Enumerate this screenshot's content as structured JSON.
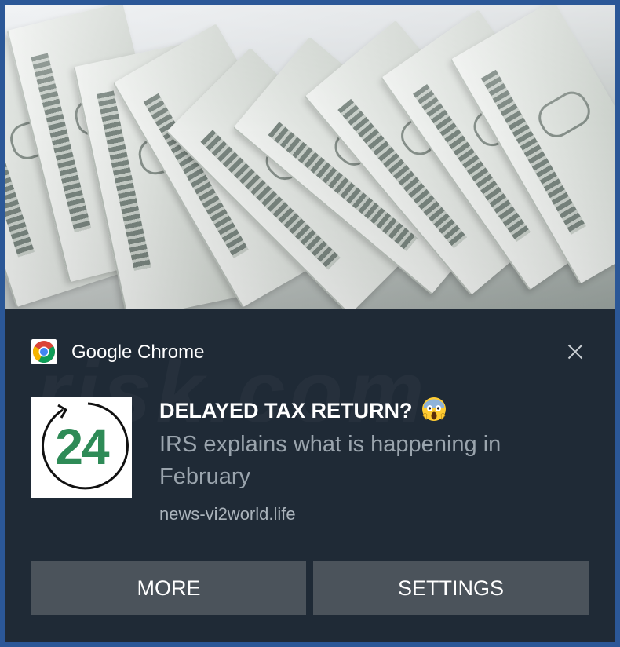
{
  "notification": {
    "app_name": "Google Chrome",
    "app_icon": "chrome-icon",
    "close_icon": "close-icon",
    "logo": {
      "text": "24",
      "icon": "circular-arrow-24-icon",
      "color": "#2e8b57"
    },
    "title": "DELAYED TAX RETURN?",
    "title_emoji": "face-screaming-in-fear-emoji",
    "body": "IRS explains what is happening in February",
    "domain": "news-vi2world.life",
    "hero_image": "hundred-dollar-bills-photo"
  },
  "actions": {
    "more_label": "MORE",
    "settings_label": "SETTINGS"
  },
  "colors": {
    "toast_background": "#1f2a36",
    "button_background": "#4b535b",
    "frame_border": "#2b5797"
  }
}
